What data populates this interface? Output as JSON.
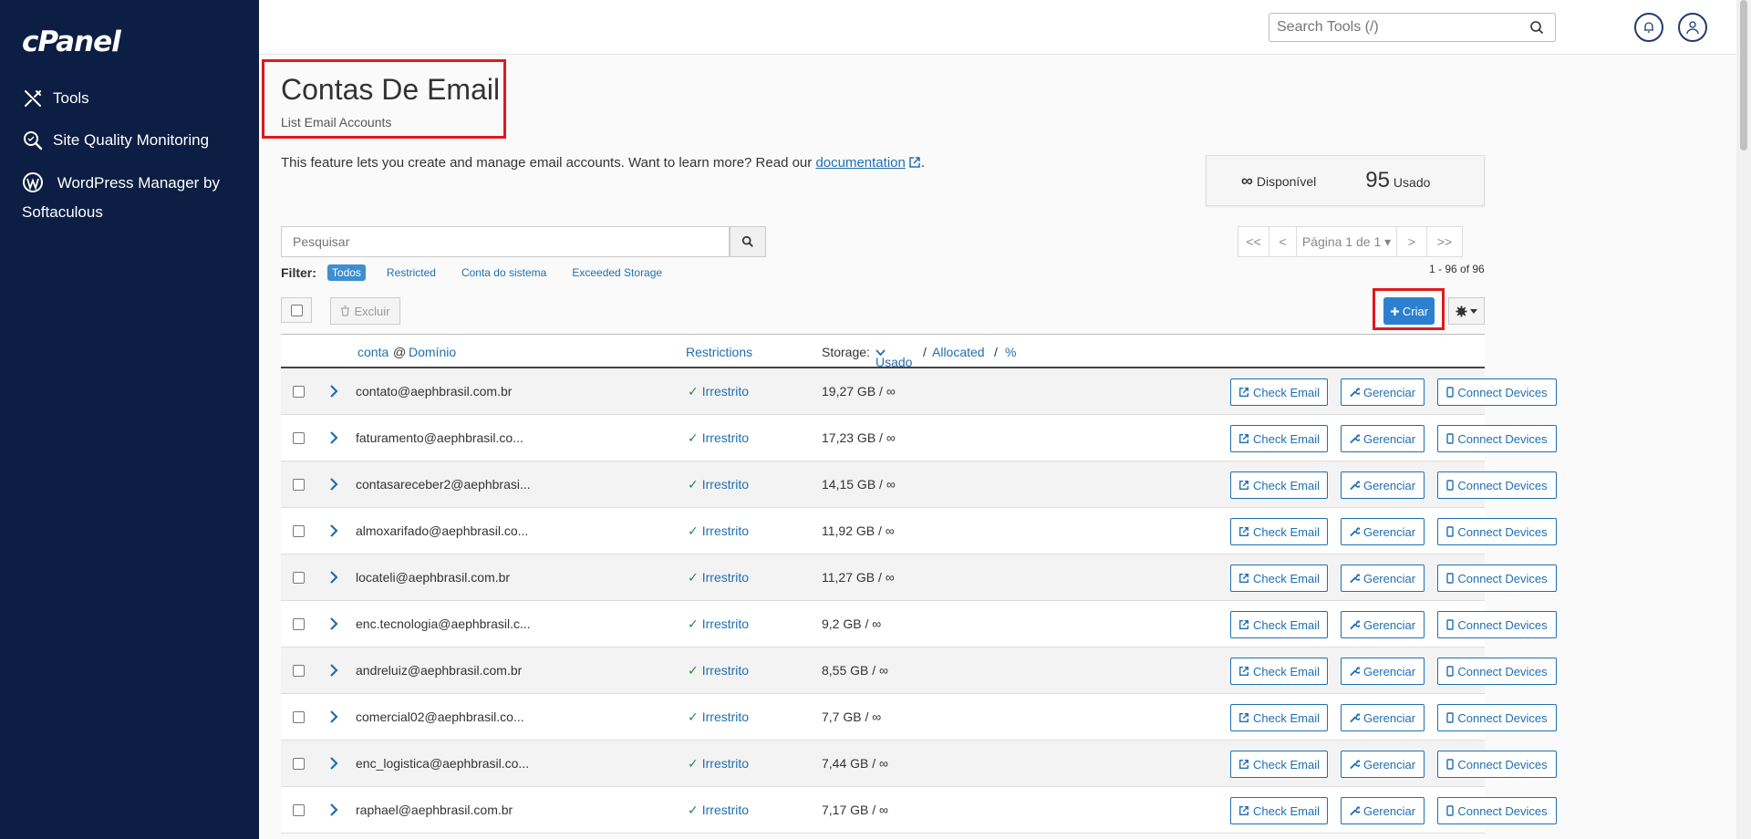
{
  "sidebar": {
    "logo": "cPanel",
    "items": [
      {
        "label": "Tools",
        "icon": "tools-icon"
      },
      {
        "label": "Site Quality Monitoring",
        "icon": "magnifier-icon"
      },
      {
        "label": "WordPress Manager by Softaculous",
        "icon": "wordpress-icon"
      }
    ]
  },
  "topbar": {
    "search_placeholder": "Search Tools (/)"
  },
  "page": {
    "title": "Contas De Email",
    "subtitle": "List Email Accounts",
    "intro_text": "This feature lets you create and manage email accounts. Want to learn more? Read our",
    "intro_link": "documentation",
    "intro_end": "."
  },
  "stats": {
    "available_symbol": "∞",
    "available_label": "Disponível",
    "used_count": "95",
    "used_label": "Usado"
  },
  "search": {
    "placeholder": "Pesquisar"
  },
  "pager": {
    "first": "<<",
    "prev": "<",
    "page_label": "Página 1 de 1",
    "next": ">",
    "last": ">>",
    "count": "1 - 96 of 96"
  },
  "filter": {
    "label": "Filter:",
    "options": [
      "Todos",
      "Restricted",
      "Conta do sistema",
      "Exceeded Storage"
    ],
    "active": "Todos"
  },
  "actions": {
    "delete": "Excluir",
    "create": "Criar"
  },
  "table": {
    "headers": {
      "account": "conta",
      "at": "@",
      "domain": "Domínio",
      "restrictions": "Restrictions",
      "storage_prefix": "Storage:",
      "used": "Usado",
      "sep1": "/",
      "allocated": "Allocated",
      "sep2": "/",
      "percent": "%"
    },
    "buttons": {
      "check": "Check Email",
      "manage": "Gerenciar",
      "devices": "Connect Devices"
    },
    "rows": [
      {
        "email": "contato@aephbrasil.com.br",
        "restriction": "Irrestrito",
        "storage": "19,27 GB / ∞"
      },
      {
        "email": "faturamento@aephbrasil.co...",
        "restriction": "Irrestrito",
        "storage": "17,23 GB / ∞"
      },
      {
        "email": "contasareceber2@aephbrasi...",
        "restriction": "Irrestrito",
        "storage": "14,15 GB / ∞"
      },
      {
        "email": "almoxarifado@aephbrasil.co...",
        "restriction": "Irrestrito",
        "storage": "11,92 GB / ∞"
      },
      {
        "email": "locateli@aephbrasil.com.br",
        "restriction": "Irrestrito",
        "storage": "11,27 GB / ∞"
      },
      {
        "email": "enc.tecnologia@aephbrasil.c...",
        "restriction": "Irrestrito",
        "storage": "9,2 GB / ∞"
      },
      {
        "email": "andreluiz@aephbrasil.com.br",
        "restriction": "Irrestrito",
        "storage": "8,55 GB / ∞"
      },
      {
        "email": "comercial02@aephbrasil.co...",
        "restriction": "Irrestrito",
        "storage": "7,7 GB / ∞"
      },
      {
        "email": "enc_logistica@aephbrasil.co...",
        "restriction": "Irrestrito",
        "storage": "7,44 GB / ∞"
      },
      {
        "email": "raphael@aephbrasil.com.br",
        "restriction": "Irrestrito",
        "storage": "7,17 GB / ∞"
      }
    ]
  }
}
